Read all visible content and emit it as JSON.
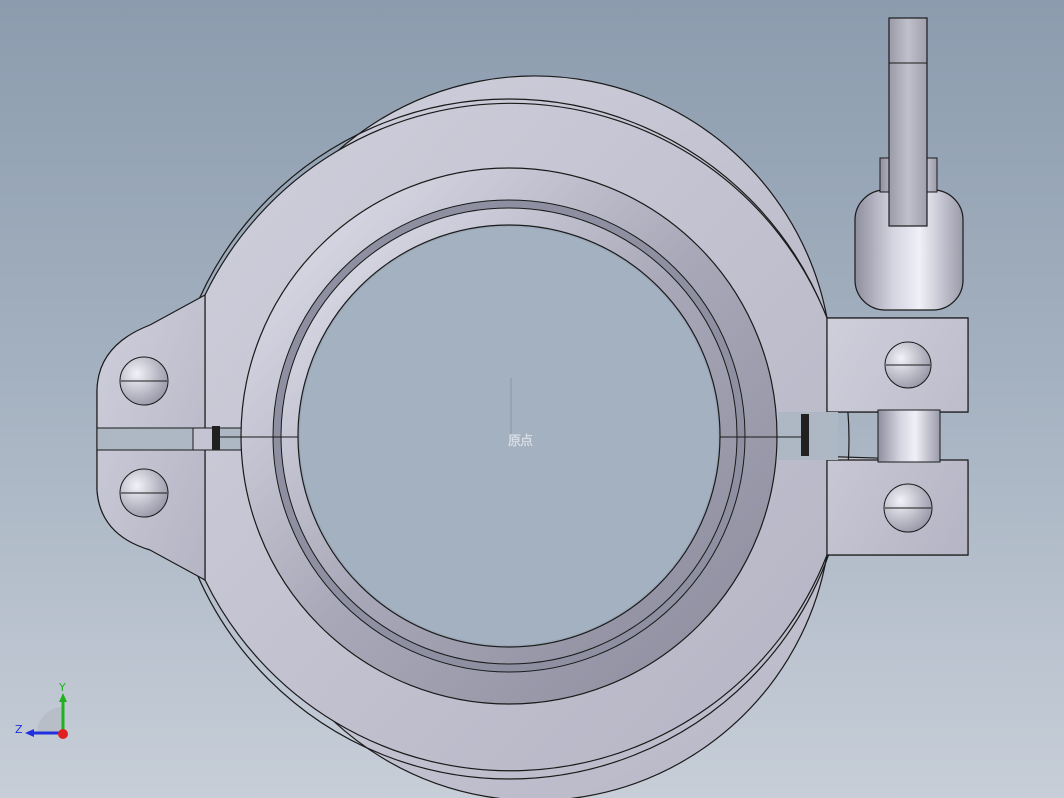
{
  "viewport": {
    "background_top": "#8c9cae",
    "background_bottom": "#c7ced8"
  },
  "model": {
    "part_color": "#c2c2d0",
    "edge_color": "#1a1a1a",
    "origin_label": "原点"
  },
  "triad": {
    "x_color": "#e02020",
    "y_color": "#20b020",
    "z_color": "#2030e0",
    "y_label": "Y",
    "z_label": "Z"
  }
}
